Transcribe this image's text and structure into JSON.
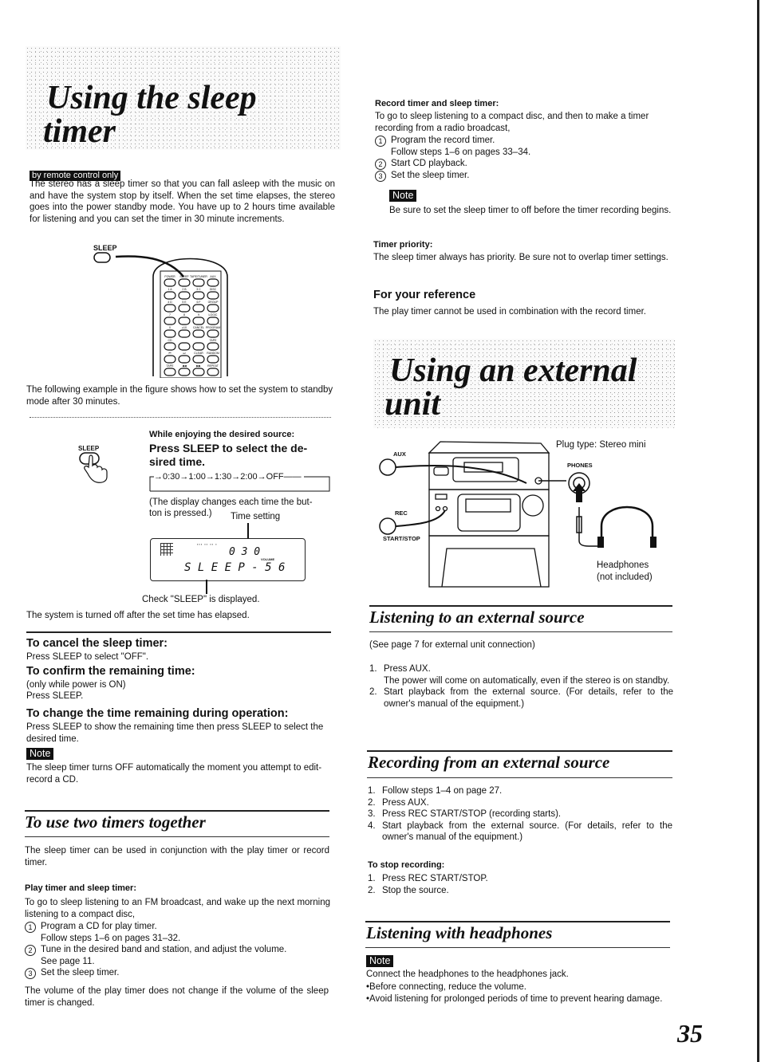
{
  "page": {
    "number": "35"
  },
  "sleep_timer": {
    "title_line1": "Using the sleep",
    "title_line2": "timer",
    "badge": "by remote control only",
    "intro": "The stereo has a sleep timer so that you can fall asleep with the music  on and have the system stop by itself. When the set time elapses, the stereo goes into the power standby mode. You have up to 2 hours time available for listening and you can set the timer in 30 minute increments.",
    "remote_figure": {
      "sleep_label": "SLEEP",
      "button_rows": [
        [
          "POWER",
          "SLEEP",
          "TAPE/TUNER",
          "AUX"
        ],
        [
          "1 A",
          "2 B",
          "3 C",
          "DISC"
        ],
        [
          "4 D",
          "5 E",
          "6 F",
          "GROUP"
        ],
        [
          "7",
          "8",
          "9",
          "LOGIC"
        ],
        [
          "0",
          "≥10",
          "CANCEL",
          "PROGRAM"
        ],
        [
          "CD",
          "",
          "",
          "TAPE"
        ],
        [
          "⏮",
          "⏭",
          "CLEAR",
          "RANDOM"
        ],
        [
          "TAPE",
          "◀◀",
          "▶▶",
          "REPEAT"
        ]
      ]
    },
    "example_text": "The following example in the figure shows how to set the system to standby mode after 30 minutes.",
    "step": {
      "icon_label": "SLEEP",
      "pre": "While enjoying the desired source:",
      "instruction": "Press SLEEP to select the desired time.",
      "instruction_line1": "Press SLEEP to select the de-",
      "instruction_line2": "sired time.",
      "sequence": [
        "0:30",
        "1:00",
        "1:30",
        "2:00",
        "OFF"
      ],
      "display_note": "(The display changes each time the button is pressed.)",
      "display_note_line1": "(The display changes each time the but-",
      "display_note_line2": "ton is pressed.)",
      "time_setting_label": "Time setting",
      "lcd": {
        "time": "0 3 0",
        "main": "S L E E P - 5 6",
        "volume_label": "VOLUME"
      },
      "check_label": "Check \"SLEEP\" is displayed.",
      "after_text": "The system is turned off after the set time has elapsed."
    },
    "cancel": {
      "heading": "To cancel the sleep timer:",
      "text": "Press SLEEP to select \"OFF\"."
    },
    "confirm": {
      "heading": "To confirm the remaining time:",
      "text1": "(only while power is ON)",
      "text2": "Press SLEEP."
    },
    "change": {
      "heading": "To change the time remaining during operation:",
      "text": "Press SLEEP to show the remaining time then press SLEEP to select the desired time."
    },
    "note": {
      "label": "Note",
      "text": "The sleep timer turns OFF automatically the moment you attempt to edit-record a CD."
    }
  },
  "two_timers": {
    "title": "To use two timers together",
    "intro": "The sleep timer can be used in conjunction with the play timer or record timer.",
    "play": {
      "heading": "Play timer and sleep timer:",
      "text": "To go to sleep listening to an FM broadcast, and wake up the next morning listening to a compact disc,",
      "steps": [
        {
          "num": "1",
          "text": "Program a CD for play timer.",
          "sub": "Follow steps 1–6 on pages 31–32."
        },
        {
          "num": "2",
          "text": "Tune in the desired band and station, and adjust the volume.",
          "sub": "See page 11."
        },
        {
          "num": "3",
          "text": "Set the sleep timer.",
          "sub": ""
        }
      ],
      "footer": "The volume of the play timer does not change if the volume of the sleep timer is changed."
    },
    "record": {
      "heading": "Record timer and sleep timer:",
      "text": "To go to sleep listening to a compact disc, and then to make a timer recording from a radio broadcast,",
      "steps": [
        {
          "num": "1",
          "text": "Program the record timer.",
          "sub": "Follow steps 1–6 on pages 33–34."
        },
        {
          "num": "2",
          "text": "Start CD playback.",
          "sub": ""
        },
        {
          "num": "3",
          "text": "Set the sleep timer.",
          "sub": ""
        }
      ],
      "note_label": "Note",
      "note_text": "Be sure to set the sleep timer to off before the timer recording begins."
    },
    "priority": {
      "heading": "Timer priority:",
      "text": "The sleep timer always has priority. Be sure not to overlap timer settings."
    },
    "reference": {
      "heading": "For your reference",
      "text": "The play timer cannot be used in combination with the record timer."
    }
  },
  "external_unit": {
    "title_line1": "Using an external",
    "title_line2": "unit",
    "figure": {
      "plug_type": "Plug type:  Stereo mini",
      "aux": "AUX",
      "rec": "REC",
      "start_stop": "START/STOP",
      "phones": "PHONES",
      "headphones": "Headphones",
      "not_included": "(not included)"
    },
    "listening": {
      "title": "Listening to an external source",
      "see": "(See page 7 for external unit connection)",
      "steps": [
        {
          "num": "1.",
          "text": "Press AUX.",
          "sub": "The power will come on automatically, even if the stereo is on standby."
        },
        {
          "num": "2.",
          "text": "Start playback from the external source. (For details, refer to the owner's manual of the equipment.)",
          "sub": ""
        }
      ]
    },
    "recording": {
      "title": "Recording from an external source",
      "steps": [
        {
          "num": "1.",
          "text": "Follow steps 1–4 on page 27."
        },
        {
          "num": "2.",
          "text": "Press AUX."
        },
        {
          "num": "3.",
          "text": "Press REC START/STOP (recording starts)."
        },
        {
          "num": "4.",
          "text": "Start playback from the external source. (For details, refer to the owner's manual of the equipment.)"
        }
      ],
      "stop_heading": "To stop recording:",
      "stop_steps": [
        {
          "num": "1.",
          "text": "Press REC START/STOP."
        },
        {
          "num": "2.",
          "text": "Stop the source."
        }
      ]
    },
    "headphones": {
      "title": "Listening with headphones",
      "note_label": "Note",
      "text": "Connect the headphones to the headphones jack.",
      "bullets": [
        "Before connecting, reduce the volume.",
        "Avoid listening for prolonged periods of time to prevent hearing damage."
      ]
    }
  }
}
